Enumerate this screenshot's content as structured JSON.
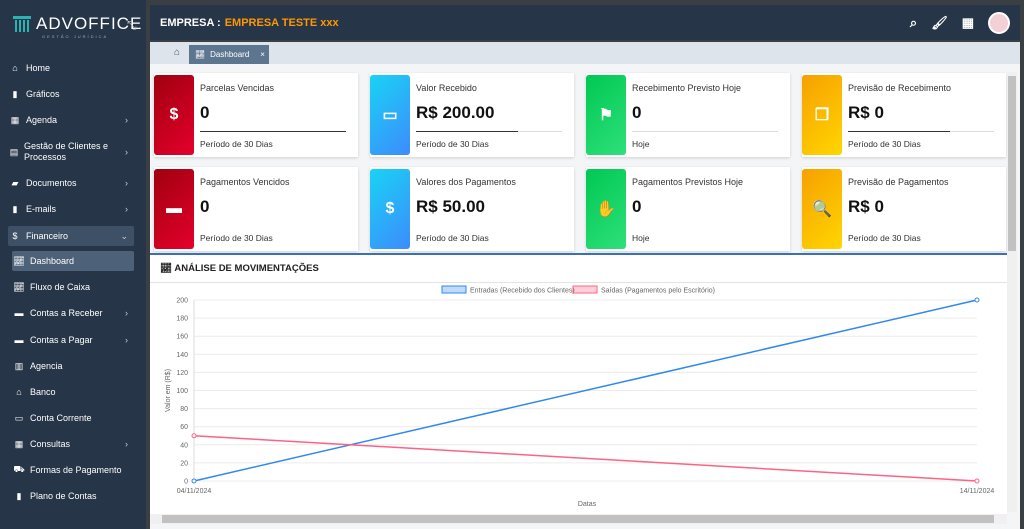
{
  "brand": {
    "name": "ADVOFFICE",
    "tagline": "GESTÃO JURÍDICA"
  },
  "sidebar": {
    "items": [
      {
        "label": "Home",
        "icon": "home-icon",
        "chev": false
      },
      {
        "label": "Gráficos",
        "icon": "file-icon",
        "chev": false
      },
      {
        "label": "Agenda",
        "icon": "calendar-icon",
        "chev": true
      },
      {
        "label": "Gestão de Clientes e Processos",
        "icon": "id-card-icon",
        "chev": true
      },
      {
        "label": "Documentos",
        "icon": "folder-icon",
        "chev": true
      },
      {
        "label": "E-mails",
        "icon": "file-icon",
        "chev": true
      },
      {
        "label": "Financeiro",
        "icon": "dollar-icon",
        "chev": true,
        "active": true
      },
      {
        "label": "Dashboard",
        "icon": "chart-line-icon",
        "sub": true,
        "active": true
      },
      {
        "label": "Fluxo de Caixa",
        "icon": "chart-line-icon",
        "sub": true
      },
      {
        "label": "Contas a Receber",
        "icon": "money-icon",
        "sub": true,
        "chev": true
      },
      {
        "label": "Contas a Pagar",
        "icon": "money-icon",
        "sub": true,
        "chev": true
      },
      {
        "label": "Agencia",
        "icon": "building-icon",
        "sub": true
      },
      {
        "label": "Banco",
        "icon": "bank-icon",
        "sub": true
      },
      {
        "label": "Conta Corrente",
        "icon": "card-icon",
        "sub": true
      },
      {
        "label": "Consultas",
        "icon": "table-icon",
        "sub": true,
        "chev": true
      },
      {
        "label": "Formas de Pagamento",
        "icon": "cart-icon",
        "sub": true
      },
      {
        "label": "Plano de Contas",
        "icon": "file-icon",
        "sub": true
      }
    ]
  },
  "header": {
    "label": "EMPRESA :",
    "company": "EMPRESA TESTE xxx"
  },
  "breadcrumb": {
    "tab": "Dashboard",
    "close": "×"
  },
  "cards": [
    {
      "label": "Parcelas Vencidas",
      "value": "0",
      "sub": "Período de 30 Dias",
      "color": "red",
      "icon": "invoice-dollar-icon",
      "glyph": "$",
      "progress": 100
    },
    {
      "label": "Valor Recebido",
      "value": "R$ 200.00",
      "sub": "Período de 30 Dias",
      "color": "blue",
      "icon": "money-bill-icon",
      "glyph": "▭",
      "progress": 70
    },
    {
      "label": "Recebimento Previsto Hoje",
      "value": "0",
      "sub": "Hoje",
      "color": "green",
      "icon": "flag-icon",
      "glyph": "⚑",
      "progress": 0
    },
    {
      "label": "Previsão de Recebimento",
      "value": "R$ 0",
      "sub": "Período de 30 Dias",
      "color": "orange",
      "icon": "copy-icon",
      "glyph": "❐",
      "progress": 70
    },
    {
      "label": "Pagamentos Vencidos",
      "value": "0",
      "sub": "Período de 30 Dias",
      "color": "red",
      "icon": "credit-card-icon",
      "glyph": "▬",
      "progress": 0
    },
    {
      "label": "Valores dos Pagamentos",
      "value": "R$ 50.00",
      "sub": "Período de 30 Dias",
      "color": "blue",
      "icon": "dollar-icon",
      "glyph": "$",
      "progress": 0
    },
    {
      "label": "Pagamentos Previstos Hoje",
      "value": "0",
      "sub": "Hoje",
      "color": "green",
      "icon": "hand-dollar-icon",
      "glyph": "✋",
      "progress": 0
    },
    {
      "label": "Previsão de Pagamentos",
      "value": "R$ 0",
      "sub": "Período de 30 Dias",
      "color": "orange",
      "icon": "search-dollar-icon",
      "glyph": "🔍",
      "progress": 0
    }
  ],
  "panel": {
    "title": "ANÁLISE DE MOVIMENTAÇÕES"
  },
  "chart_data": {
    "type": "line",
    "categories": [
      "04/11/2024",
      "14/11/2024"
    ],
    "series": [
      {
        "name": "Entradas (Recebido dos Clientes)",
        "values": [
          0,
          200
        ],
        "color": "#2f88f0"
      },
      {
        "name": "Saídas (Pagamentos pelo Escritório)",
        "values": [
          50,
          0
        ],
        "color": "#ff6384"
      }
    ],
    "ylabel": "Valor em (R$)",
    "xlabel": "Datas",
    "ylim": [
      0,
      200
    ],
    "yticks": [
      0,
      20,
      40,
      60,
      80,
      100,
      120,
      140,
      160,
      180,
      200
    ],
    "grid": true,
    "legend": "top"
  }
}
